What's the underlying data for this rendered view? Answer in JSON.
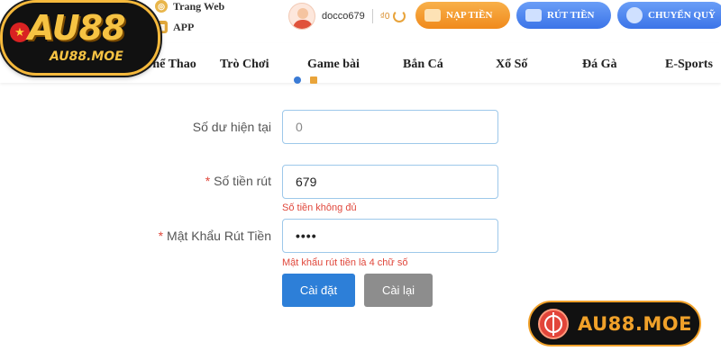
{
  "header": {
    "links": [
      {
        "label": "Trang Web",
        "icon": "globe-icon"
      },
      {
        "label": "APP",
        "icon": "app-icon"
      }
    ],
    "username": "docco679",
    "balance": "₫0",
    "buttons": {
      "deposit": "NẠP TIỀN",
      "withdraw": "RÚT TIỀN",
      "transfer": "CHUYỂN QUỸ"
    }
  },
  "logo": {
    "brand": "AU88",
    "domain": "AU88.MOE"
  },
  "nav": {
    "items": [
      "Thể Thao",
      "Trò Chơi",
      "Game bài",
      "Bắn Cá",
      "Xổ Số",
      "Đá Gà",
      "E-Sports"
    ]
  },
  "form": {
    "balance_label": "Số dư hiện tại",
    "balance_placeholder": "0",
    "amount_label": "Số tiền rút",
    "amount_value": "679",
    "amount_error": "Số tiền không đủ",
    "password_label": "Mật Khẩu Rút Tiền",
    "password_value": "••••",
    "password_error": "Mật khẩu rút tiền là 4 chữ số",
    "required_mark": "*",
    "save_label": "Cài đặt",
    "reset_label": "Cài lại"
  },
  "watermark": {
    "text": "AU88.MOE"
  },
  "colors": {
    "primary_blue": "#2d7fd8",
    "error_red": "#e0473b",
    "deposit_orange": "#f08a1c",
    "brand_gold": "#f6c343"
  }
}
